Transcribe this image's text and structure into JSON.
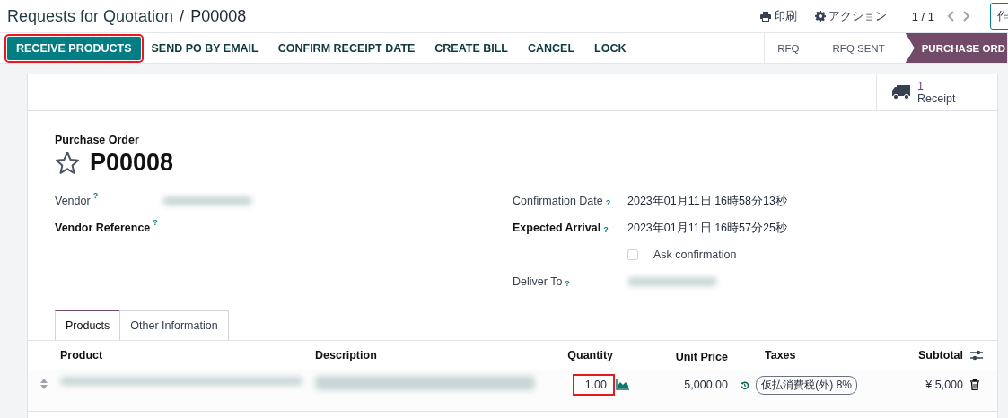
{
  "breadcrumb": {
    "parent": "Requests for Quotation",
    "separator": "/",
    "current": "P00008"
  },
  "top_actions": [
    {
      "kind": "print",
      "label": "印刷"
    },
    {
      "kind": "gear",
      "label": "アクション"
    }
  ],
  "pager": {
    "value": "1 / 1"
  },
  "new_button": {
    "label": "作"
  },
  "action_buttons": [
    {
      "label": "RECEIVE PRODUCTS",
      "primary": true,
      "highlighted": true
    },
    {
      "label": "SEND PO BY EMAIL",
      "primary": false,
      "highlighted": false
    },
    {
      "label": "CONFIRM RECEIPT DATE",
      "primary": false,
      "highlighted": false
    },
    {
      "label": "CREATE BILL",
      "primary": false,
      "highlighted": false
    },
    {
      "label": "CANCEL",
      "primary": false,
      "highlighted": false
    },
    {
      "label": "LOCK",
      "primary": false,
      "highlighted": false
    }
  ],
  "stages": [
    {
      "label": "RFQ",
      "selected": false
    },
    {
      "label": "RFQ SENT",
      "selected": false
    },
    {
      "label": "PURCHASE ORD",
      "selected": true
    }
  ],
  "smart_button": {
    "count": "1",
    "label": "Receipt"
  },
  "form": {
    "caption": "Purchase Order",
    "name": "P00008",
    "starred": false,
    "left_fields": [
      {
        "label": "Vendor",
        "help": "?",
        "bold": false,
        "value_hidden": true
      },
      {
        "label": "Vendor Reference",
        "help": "?",
        "bold": true
      }
    ],
    "right_fields": [
      {
        "kind": "text",
        "label": "Confirmation Date",
        "help": "?",
        "bold": false,
        "value": "2023年01月11日 16時58分13秒"
      },
      {
        "kind": "text",
        "label": "Expected Arrival",
        "help": "?",
        "bold": true,
        "value": "2023年01月11日 16時57分25秒"
      },
      {
        "kind": "checkbox",
        "label": "Ask confirmation",
        "checked": false
      },
      {
        "kind": "hidden",
        "label": "Deliver To",
        "help": "?",
        "bold": false
      }
    ]
  },
  "tabs": [
    {
      "label": "Products",
      "selected": true
    },
    {
      "label": "Other Information",
      "selected": false
    }
  ],
  "table": {
    "columns": [
      "Product",
      "Description",
      "Quantity",
      "Unit Price",
      "Taxes",
      "Subtotal"
    ],
    "rows": [
      {
        "quantity": "1.00",
        "quantity_highlighted": true,
        "unit_price": "5,000.00",
        "tax": "仮払消費税(外) 8%",
        "subtotal": "¥ 5,000"
      }
    ]
  }
}
